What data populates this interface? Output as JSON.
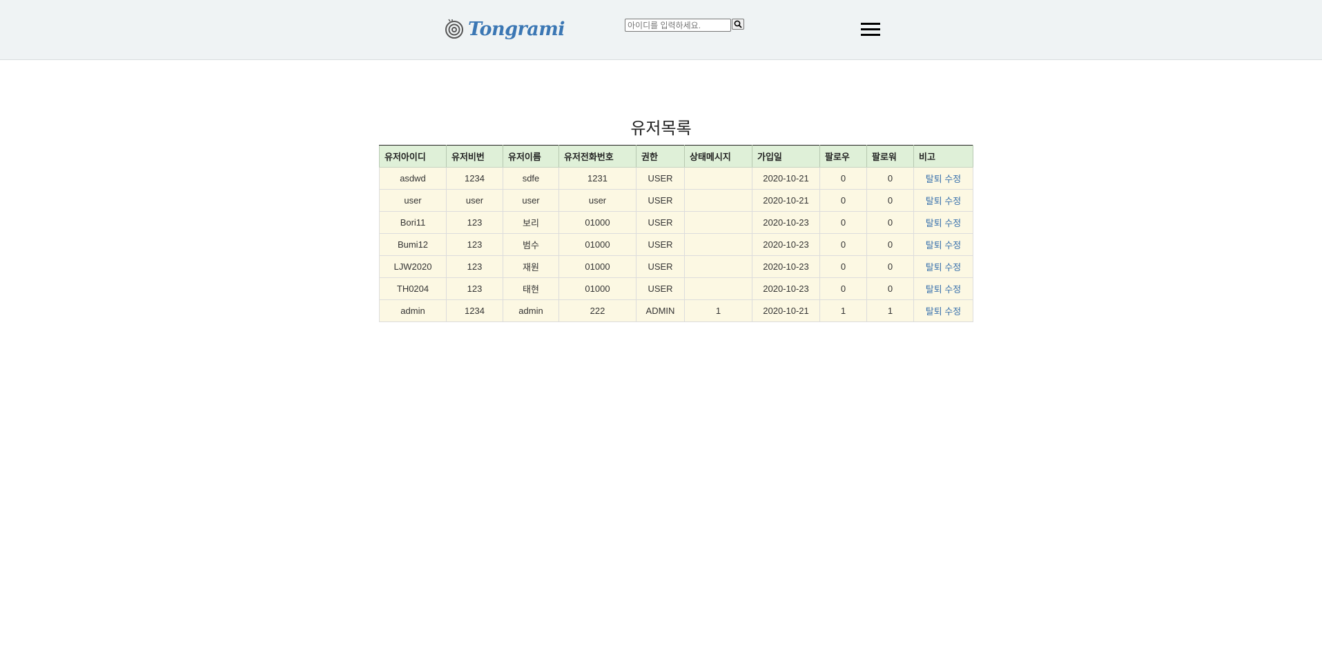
{
  "header": {
    "brand": "Tongrami",
    "search_placeholder": "아이디를 입력하세요."
  },
  "main": {
    "title": "유저목록",
    "columns": [
      "유저아이디",
      "유저비번",
      "유저이름",
      "유저전화번호",
      "권한",
      "상태메시지",
      "가입일",
      "팔로우",
      "팔로워",
      "비고"
    ],
    "rows": [
      {
        "id": "asdwd",
        "pw": "1234",
        "name": "sdfe",
        "phone": "1231",
        "role": "USER",
        "status": "",
        "joined": "2020-10-21",
        "follow": "0",
        "follower": "0"
      },
      {
        "id": "user",
        "pw": "user",
        "name": "user",
        "phone": "user",
        "role": "USER",
        "status": "",
        "joined": "2020-10-21",
        "follow": "0",
        "follower": "0"
      },
      {
        "id": "Bori11",
        "pw": "123",
        "name": "보리",
        "phone": "01000",
        "role": "USER",
        "status": "",
        "joined": "2020-10-23",
        "follow": "0",
        "follower": "0"
      },
      {
        "id": "Bumi12",
        "pw": "123",
        "name": "범수",
        "phone": "01000",
        "role": "USER",
        "status": "",
        "joined": "2020-10-23",
        "follow": "0",
        "follower": "0"
      },
      {
        "id": "LJW2020",
        "pw": "123",
        "name": "재원",
        "phone": "01000",
        "role": "USER",
        "status": "",
        "joined": "2020-10-23",
        "follow": "0",
        "follower": "0"
      },
      {
        "id": "TH0204",
        "pw": "123",
        "name": "태현",
        "phone": "01000",
        "role": "USER",
        "status": "",
        "joined": "2020-10-23",
        "follow": "0",
        "follower": "0"
      },
      {
        "id": "admin",
        "pw": "1234",
        "name": "admin",
        "phone": "222",
        "role": "ADMIN",
        "status": "1",
        "joined": "2020-10-21",
        "follow": "1",
        "follower": "1"
      }
    ],
    "action_withdraw": "탈퇴",
    "action_edit": "수정"
  },
  "colors": {
    "header_bg": "#eff3f4",
    "brand": "#3b77b4",
    "table_head_bg": "#dff0d8",
    "table_row_bg": "#fcf8e3",
    "link": "#3a72ad"
  }
}
